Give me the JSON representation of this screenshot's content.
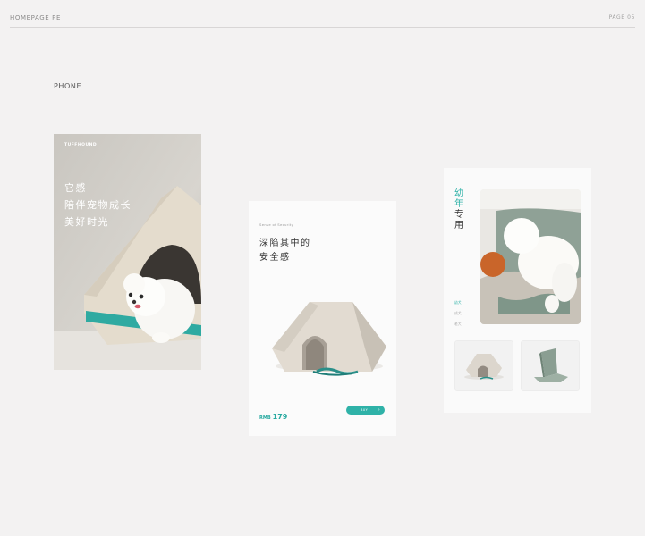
{
  "header": {
    "title": "HOMEPAGE PE",
    "page": "PAGE 05"
  },
  "section": {
    "label": "PHONE"
  },
  "phone1": {
    "brand": "TUFFHOUND",
    "lines": [
      "它感",
      "陪伴宠物成长",
      "美好时光"
    ]
  },
  "phone2": {
    "eyebrow": "Sense of Security",
    "headline": [
      "深陷其中的",
      "安全感"
    ],
    "currency": "RMB",
    "price": "179",
    "button_label": "BUY"
  },
  "phone3": {
    "title": {
      "accent": "幼年",
      "rest": "专用"
    },
    "tags": [
      "幼犬",
      "成犬",
      "老犬"
    ],
    "active_tag": 0
  },
  "colors": {
    "accent": "#2fb2a8",
    "background": "#f3f2f2",
    "card": "#fbfbfb"
  }
}
